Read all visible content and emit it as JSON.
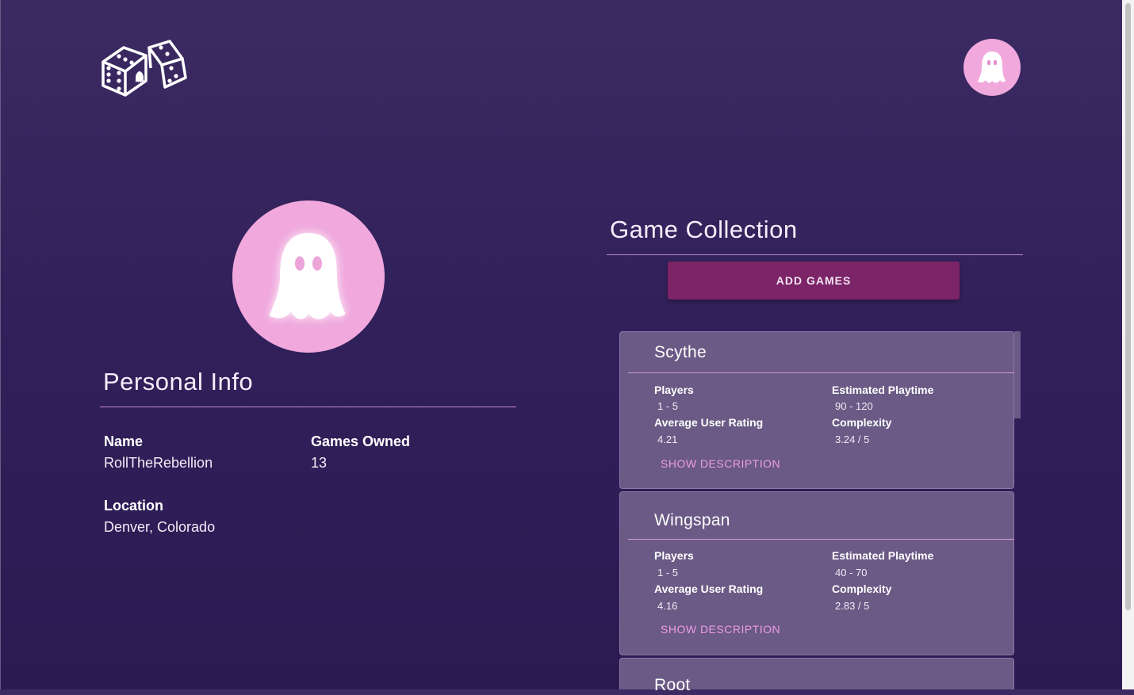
{
  "header": {
    "logo_icon": "dice-logo-icon",
    "avatar_icon": "ghost-icon"
  },
  "profile": {
    "avatar_icon": "ghost-icon",
    "section_title": "Personal Info",
    "fields": {
      "name_label": "Name",
      "name_value": "RollTheRebellion",
      "games_owned_label": "Games Owned",
      "games_owned_value": "13",
      "location_label": "Location",
      "location_value": "Denver, Colorado"
    }
  },
  "collection": {
    "section_title": "Game Collection",
    "add_button_label": "ADD GAMES",
    "games": [
      {
        "name": "Scythe",
        "players_label": "Players",
        "players": "1 - 5",
        "playtime_label": "Estimated Playtime",
        "playtime": "90 - 120",
        "rating_label": "Average User Rating",
        "rating": "4.21",
        "complexity_label": "Complexity",
        "complexity": "3.24 / 5",
        "show_description_label": "SHOW DESCRIPTION"
      },
      {
        "name": "Wingspan",
        "players_label": "Players",
        "players": "1 - 5",
        "playtime_label": "Estimated Playtime",
        "playtime": "40 - 70",
        "rating_label": "Average User Rating",
        "rating": "4.16",
        "complexity_label": "Complexity",
        "complexity": "2.83 / 5",
        "show_description_label": "SHOW DESCRIPTION"
      },
      {
        "name": "Root"
      }
    ]
  },
  "colors": {
    "accent_pink": "#f0a8dd",
    "button_bg": "#7b2467",
    "card_bg": "#6a5a85",
    "link_pink": "#ef9be6"
  }
}
